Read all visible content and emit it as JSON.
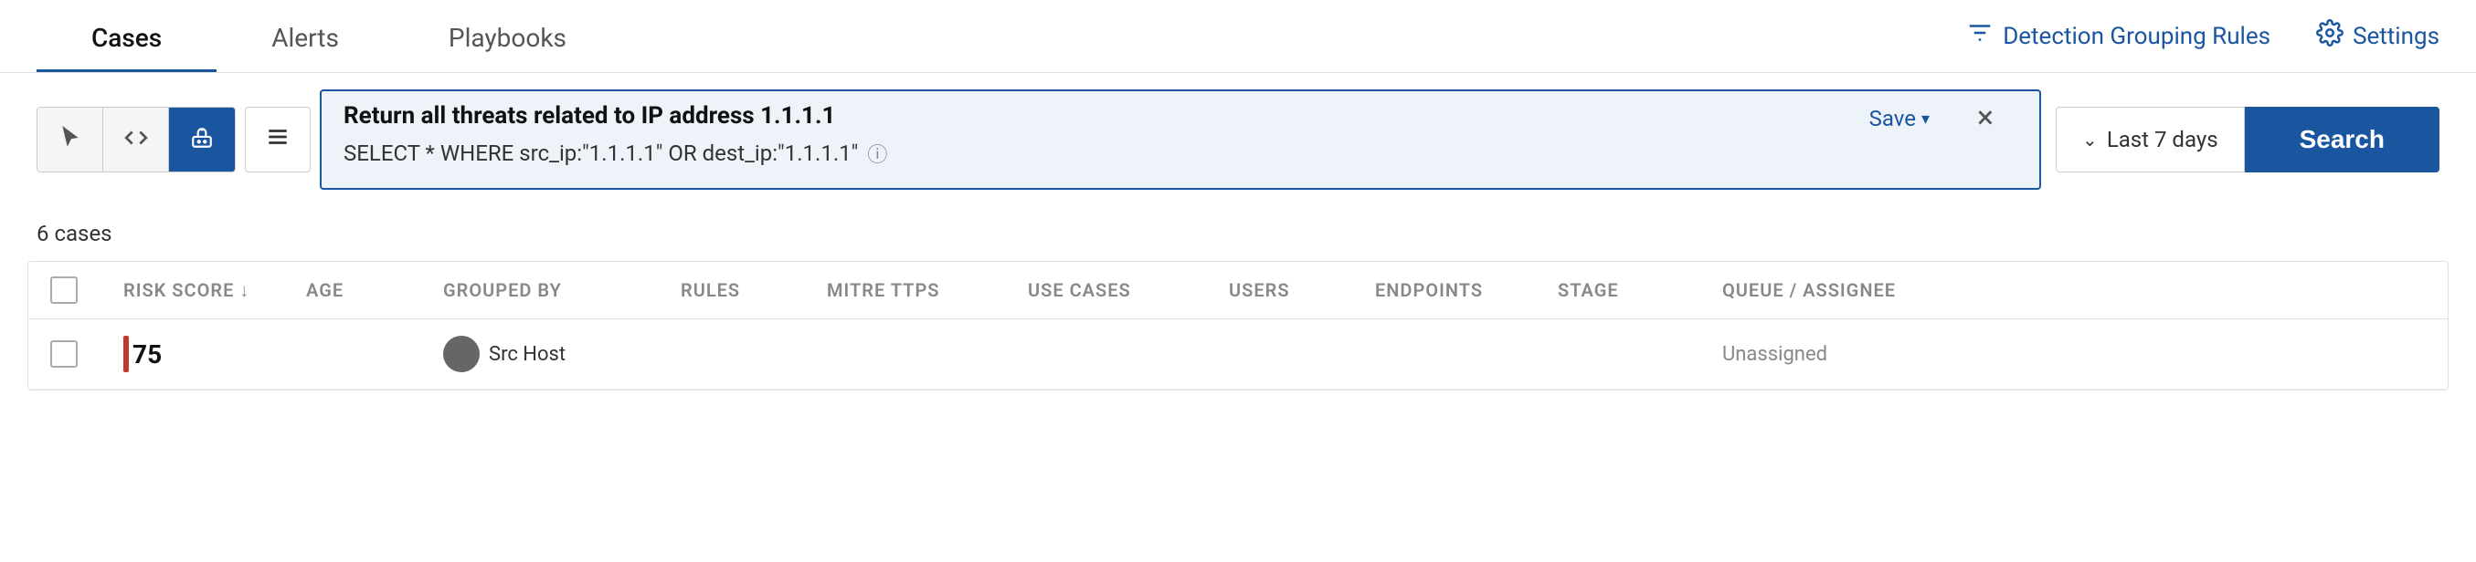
{
  "nav": {
    "tabs": [
      {
        "label": "Cases",
        "active": true
      },
      {
        "label": "Alerts",
        "active": false
      },
      {
        "label": "Playbooks",
        "active": false
      }
    ],
    "right_items": [
      {
        "label": "Detection Grouping Rules",
        "icon": "filter-icon"
      },
      {
        "label": "Settings",
        "icon": "settings-icon"
      }
    ]
  },
  "toolbar": {
    "icons": [
      {
        "name": "cursor-icon",
        "active": false,
        "symbol": "↖"
      },
      {
        "name": "code-icon",
        "active": false,
        "symbol": "</>"
      },
      {
        "name": "bot-icon",
        "active": true,
        "symbol": "⚙"
      }
    ],
    "list_icon": "≡",
    "search": {
      "title": "Return all threats related to IP address 1.1.1.1",
      "query": "SELECT * WHERE src_ip:\"1.1.1.1\" OR dest_ip:\"1.1.1.1\"",
      "save_label": "Save",
      "close_label": "×"
    },
    "date_filter": {
      "label": "Last 7 days",
      "icon": "chevron-down"
    },
    "search_button": "Search"
  },
  "results": {
    "count_label": "6 cases"
  },
  "table": {
    "columns": [
      {
        "label": "RISK SCORE",
        "sortable": true
      },
      {
        "label": "AGE",
        "sortable": false
      },
      {
        "label": "GROUPED BY",
        "sortable": false
      },
      {
        "label": "RULES",
        "sortable": false
      },
      {
        "label": "MITRE TTPS",
        "sortable": false
      },
      {
        "label": "USE CASES",
        "sortable": false
      },
      {
        "label": "USERS",
        "sortable": false
      },
      {
        "label": "ENDPOINTS",
        "sortable": false
      },
      {
        "label": "STAGE",
        "sortable": false
      },
      {
        "label": "QUEUE / ASSIGNEE",
        "sortable": false
      }
    ],
    "rows": [
      {
        "risk_score": "75",
        "age": "",
        "grouped_by": "Src Host",
        "rules": "",
        "mitre_ttps": "",
        "use_cases": "",
        "users": "",
        "endpoints": "",
        "stage": "",
        "queue_assignee": "Unassigned"
      }
    ]
  }
}
